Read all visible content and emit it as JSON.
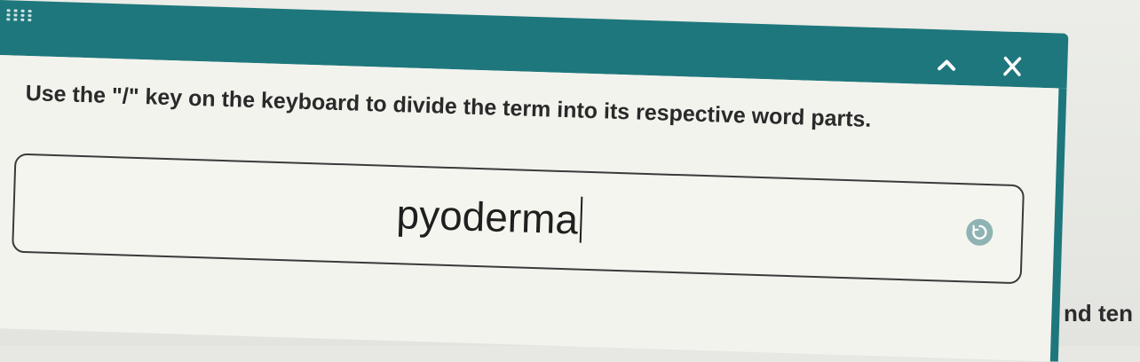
{
  "panel": {
    "header": {
      "collapse_icon": "chevron-up-icon",
      "close_icon": "close-icon",
      "drag_icon": "drag-handle-icon",
      "color": "#1e777c"
    },
    "instruction": "Use the \"/\" key on the keyboard to divide the term into its respective word parts.",
    "answer": {
      "value": "pyoderma",
      "status_icon": "loading-spinner-icon"
    }
  },
  "background": {
    "partial_text": "nd ten"
  }
}
